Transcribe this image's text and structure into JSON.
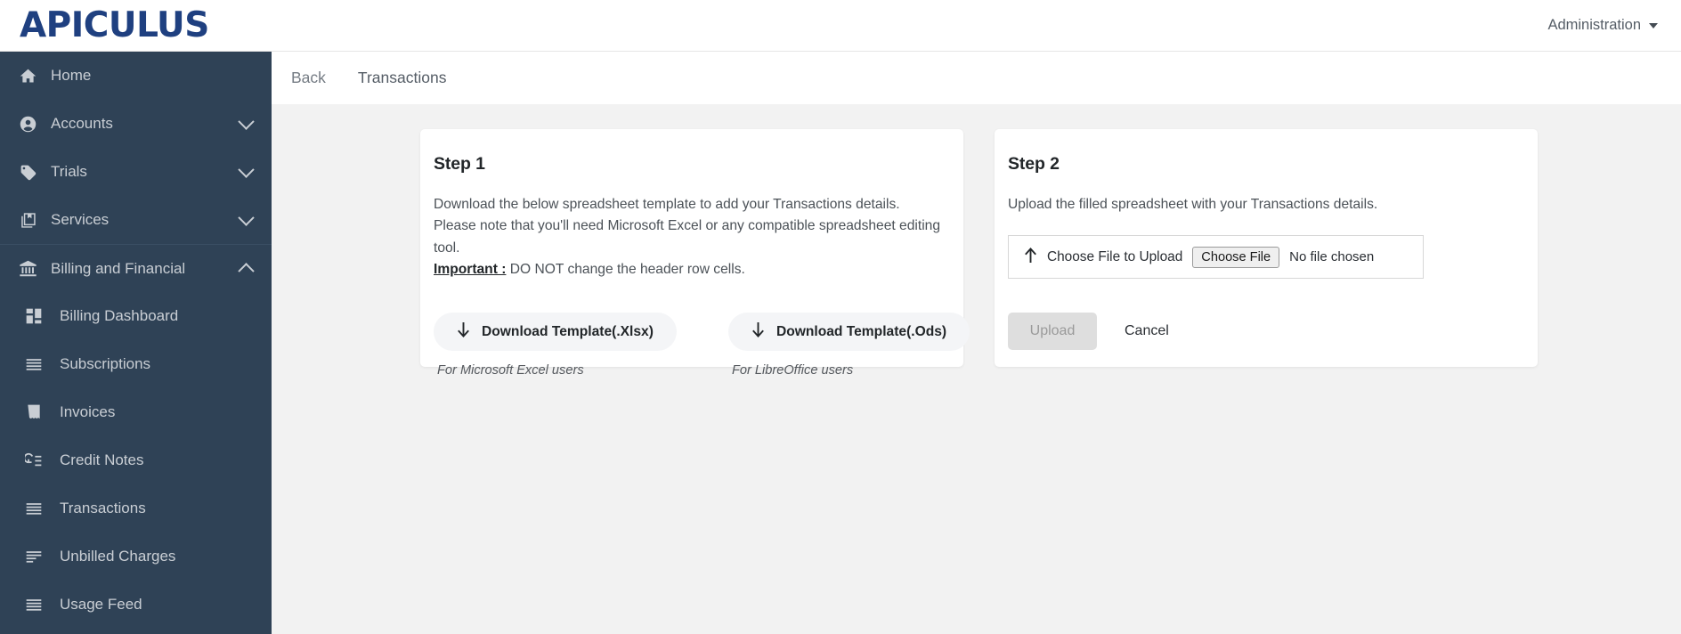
{
  "brand": {
    "logo_text": "APICULUS",
    "logo_color": "#1f4080"
  },
  "topbar": {
    "account_menu_label": "Administration"
  },
  "theme": {
    "sidebar_bg": "#2f4256",
    "content_bg": "#f2f2f2",
    "card_bg": "#ffffff"
  },
  "sidebar": {
    "items": [
      {
        "label": "Home",
        "icon": "home-icon",
        "expandable": false,
        "sub": false
      },
      {
        "label": "Accounts",
        "icon": "account-circle-icon",
        "expandable": true,
        "expanded": false,
        "sub": false
      },
      {
        "label": "Trials",
        "icon": "tag-icon",
        "expandable": true,
        "expanded": false,
        "sub": false
      },
      {
        "label": "Services",
        "icon": "layers-bookmark-icon",
        "expandable": true,
        "expanded": false,
        "sub": false
      },
      {
        "label": "Billing and Financial",
        "icon": "bank-icon",
        "expandable": true,
        "expanded": true,
        "sub": false,
        "divider_above": true
      },
      {
        "label": "Billing Dashboard",
        "icon": "dashboard-grid-icon",
        "expandable": false,
        "sub": true
      },
      {
        "label": "Subscriptions",
        "icon": "list-lines-icon",
        "expandable": false,
        "sub": true
      },
      {
        "label": "Invoices",
        "icon": "receipt-icon",
        "expandable": false,
        "sub": true
      },
      {
        "label": "Credit Notes",
        "icon": "credit-note-icon",
        "expandable": false,
        "sub": true
      },
      {
        "label": "Transactions",
        "icon": "list-lines-icon",
        "expandable": false,
        "sub": true
      },
      {
        "label": "Unbilled Charges",
        "icon": "list-left-align-icon",
        "expandable": false,
        "sub": true
      },
      {
        "label": "Usage Feed",
        "icon": "list-lines-icon",
        "expandable": false,
        "sub": true
      }
    ]
  },
  "breadcrumb": {
    "back_label": "Back",
    "current_label": "Transactions"
  },
  "step1": {
    "title": "Step 1",
    "line1": "Download the below spreadsheet template to add your Transactions details.",
    "line2": "Please note that you'll need Microsoft Excel or any compatible spreadsheet editing tool.",
    "important_label": "Important :",
    "important_text": " DO NOT change the header row cells.",
    "download_xlsx_label": "Download Template(.Xlsx)",
    "download_xlsx_caption": "For Microsoft Excel users",
    "download_ods_label": "Download Template(.Ods)",
    "download_ods_caption": "For LibreOffice users"
  },
  "step2": {
    "title": "Step 2",
    "line1": "Upload the filled spreadsheet with your Transactions details.",
    "file_field_label": "Choose File to Upload",
    "choose_file_button": "Choose File",
    "no_file_text": "No file chosen",
    "upload_label": "Upload",
    "upload_disabled": true,
    "cancel_label": "Cancel"
  }
}
